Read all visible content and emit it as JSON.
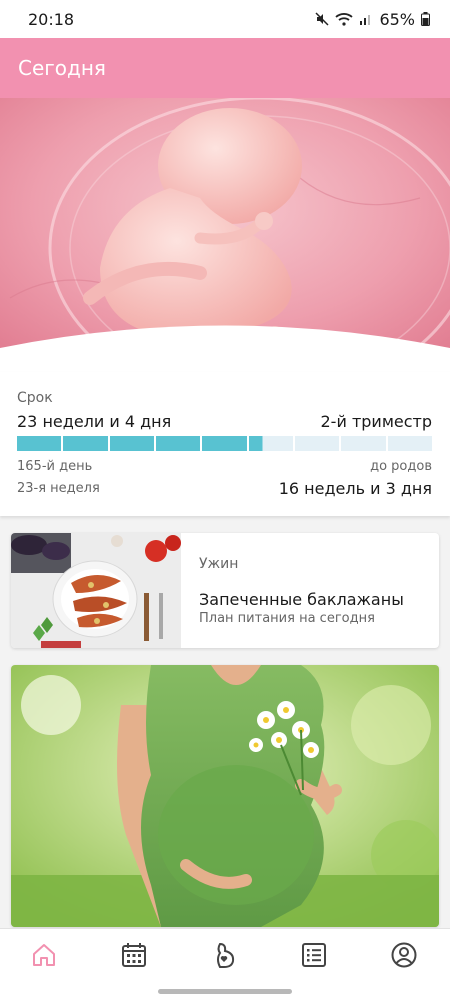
{
  "status_bar": {
    "time": "20:18",
    "battery": "65%"
  },
  "app_bar": {
    "title": "Сегодня"
  },
  "pregnancy": {
    "term_label": "Срок",
    "term_value": "23 недели и 4 дня",
    "trimester": "2-й триместр",
    "progress_segments_total": 9,
    "progress_fraction": 0.59,
    "day": "165-й день",
    "week": "23-я неделя",
    "until_birth_label": "до родов",
    "until_birth_value": "16 недель и 3 дня"
  },
  "meal": {
    "type": "Ужин",
    "title": "Запеченные баклажаны",
    "subtitle": "План питания на сегодня"
  },
  "bottom_nav": {
    "items": [
      {
        "icon": "home-icon",
        "active": true
      },
      {
        "icon": "calendar-icon",
        "active": false
      },
      {
        "icon": "pregnancy-icon",
        "active": false
      },
      {
        "icon": "checklist-icon",
        "active": false
      },
      {
        "icon": "profile-icon",
        "active": false
      }
    ]
  },
  "colors": {
    "accent": "#f291b0",
    "progress_fill": "#58c2d1",
    "progress_empty": "#e4f0f6"
  }
}
